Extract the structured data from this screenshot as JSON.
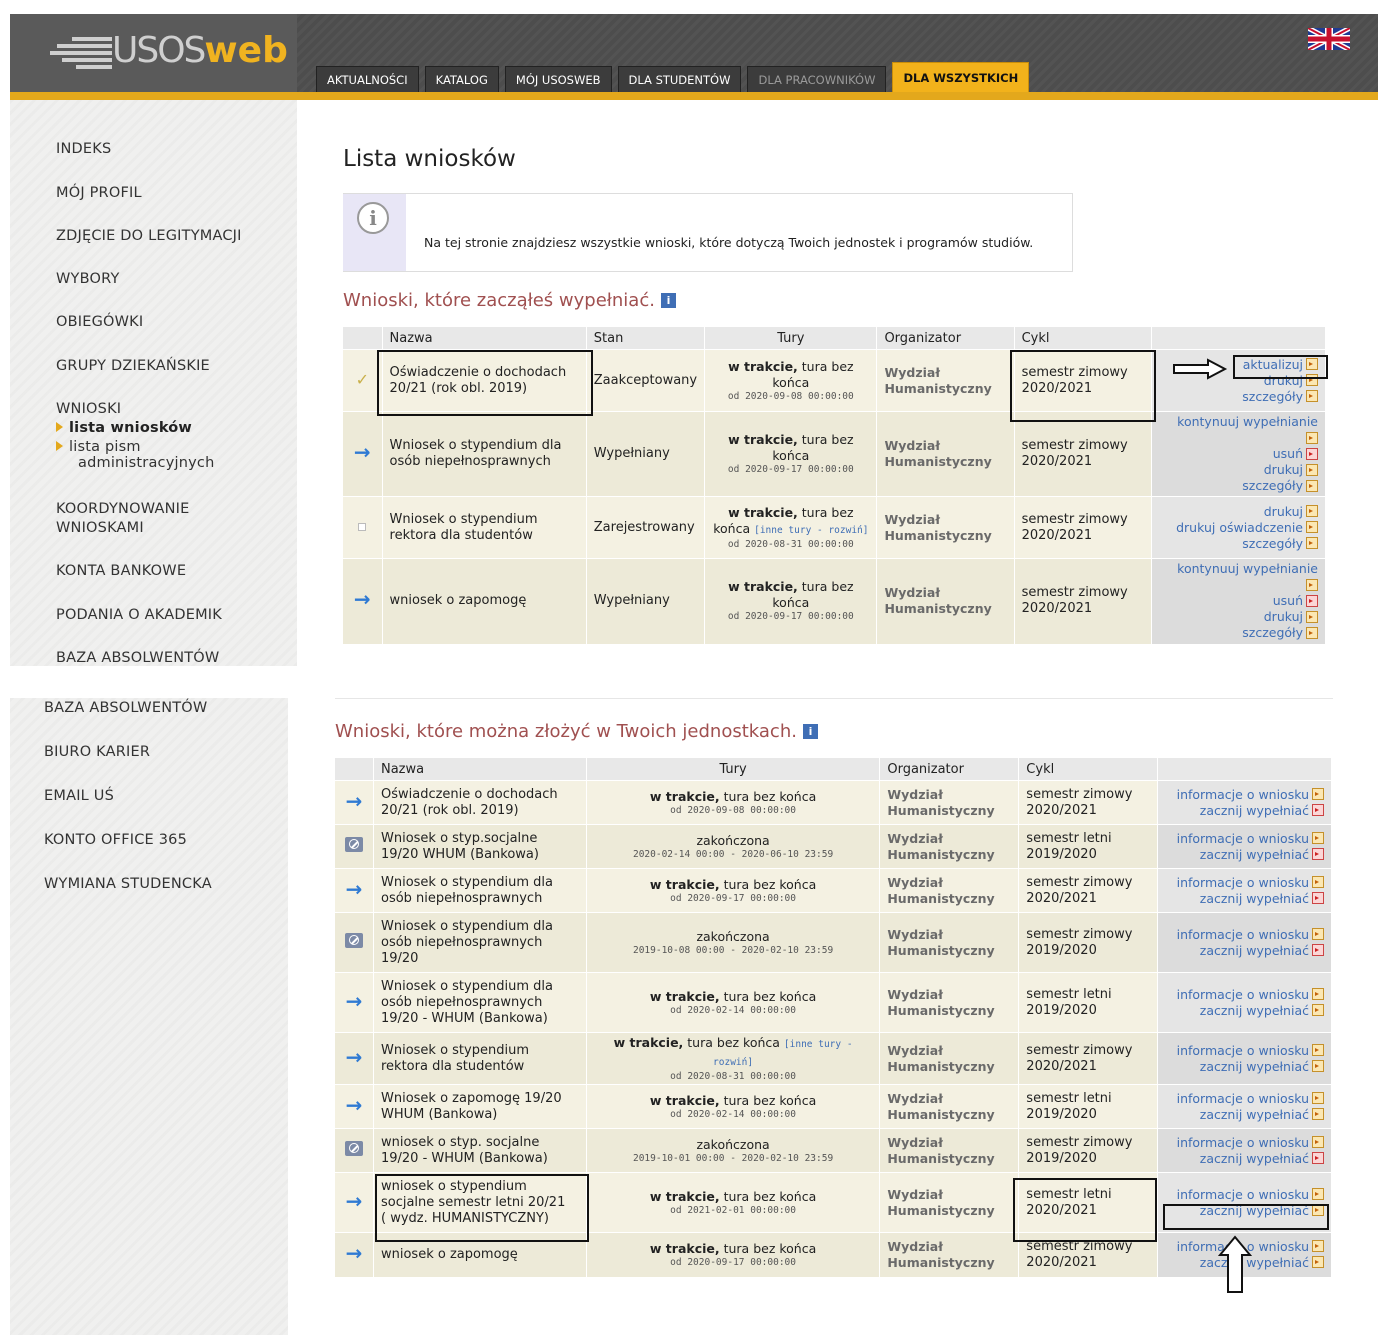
{
  "header": {
    "logo_text_a": "USOS",
    "logo_text_b": "web",
    "tabs": [
      {
        "label": "AKTUALNOŚCI",
        "state": "normal"
      },
      {
        "label": "KATALOG",
        "state": "normal"
      },
      {
        "label": "MÓJ USOSWEB",
        "state": "normal"
      },
      {
        "label": "DLA STUDENTÓW",
        "state": "normal"
      },
      {
        "label": "DLA PRACOWNIKÓW",
        "state": "dim"
      },
      {
        "label": "DLA WSZYSTKICH",
        "state": "active"
      }
    ],
    "flag_icon": "uk-flag-icon",
    "accent": "#e3a81c"
  },
  "sidebar": {
    "items_top": [
      "INDEKS",
      "MÓJ PROFIL",
      "ZDJĘCIE DO LEGITYMACJI",
      "WYBORY",
      "OBIEGÓWKI",
      "GRUPY DZIEKAŃSKIE",
      "WNIOSKI"
    ],
    "sub_items": [
      {
        "label": "lista wniosków",
        "active": true
      },
      {
        "label": "lista pism administracyjnych",
        "label_line1": "lista pism",
        "label_line2": "administracyjnych",
        "active": false
      }
    ],
    "items_mid": [
      {
        "line1": "KOORDYNOWANIE",
        "line2": "WNIOSKAMI"
      }
    ],
    "items_bottom1": [
      "KONTA BANKOWE",
      "PODANIA O AKADEMIK",
      "BAZA ABSOLWENTÓW"
    ],
    "items_bottom2": [
      "BAZA ABSOLWENTÓW",
      "BIURO KARIER",
      "EMAIL UŚ",
      "KONTO OFFICE 365",
      "WYMIANA STUDENCKA"
    ]
  },
  "main": {
    "title": "Lista wniosków",
    "info_text": "Na tej stronie znajdziesz wszystkie wnioski, które dotyczą Twoich jednostek i programów studiów.",
    "section1_title": "Wnioski, które zacząłeś wypełniać.",
    "section2_title": "Wnioski, które można złożyć w Twoich jednostkach.",
    "table1": {
      "headers": [
        "",
        "Nazwa",
        "Stan",
        "Tury",
        "Organizator",
        "Cykl",
        ""
      ],
      "rows": [
        {
          "icon": "check-icon",
          "name": "Oświadczenie o dochodach 20/21 (rok obl. 2019)",
          "name1": "Oświadczenie o dochodach",
          "name2": "20/21 (rok obl. 2019)",
          "state": "Zaakceptowany",
          "tury_bold": "w trakcie,",
          "tury_rest": " tura bez",
          "tury_line2": "końca",
          "tury_more": "",
          "tury_date": "od 2020-09-08 00:00:00",
          "org1": "Wydział",
          "org2": "Humanistyczny",
          "cycle1": "semestr zimowy",
          "cycle2": "2020/2021",
          "actions": [
            {
              "label": "aktualizuj",
              "icon": "arrow-right-icon"
            },
            {
              "label": "drukuj",
              "icon": "arrow-right-icon"
            },
            {
              "label": "szczegóły",
              "icon": "arrow-right-icon"
            }
          ]
        },
        {
          "icon": "arrow-right-icon",
          "name1": "Wniosek o stypendium dla",
          "name2": "osób niepełnosprawnych",
          "state": "Wypełniany",
          "tury_bold": "w trakcie,",
          "tury_rest": " tura bez",
          "tury_line2": "końca",
          "tury_more": "",
          "tury_date": "od 2020-09-17 00:00:00",
          "org1": "Wydział",
          "org2": "Humanistyczny",
          "cycle1": "semestr zimowy",
          "cycle2": "2020/2021",
          "actions": [
            {
              "label": "kontynuuj wypełnianie",
              "icon": "arrow-right-icon"
            },
            {
              "label": "usuń",
              "icon": "delete-icon"
            },
            {
              "label": "drukuj",
              "icon": "arrow-right-icon"
            },
            {
              "label": "szczegóły",
              "icon": "arrow-right-icon"
            }
          ]
        },
        {
          "icon": "square-icon",
          "name1": "Wniosek o stypendium",
          "name2": "rektora dla studentów",
          "state": "Zarejestrowany",
          "tury_bold": "w trakcie,",
          "tury_rest": " tura bez",
          "tury_line2": "końca",
          "tury_more": "[inne tury - rozwiń]",
          "tury_date": "od 2020-08-31 00:00:00",
          "org1": "Wydział",
          "org2": "Humanistyczny",
          "cycle1": "semestr zimowy",
          "cycle2": "2020/2021",
          "actions": [
            {
              "label": "drukuj",
              "icon": "arrow-right-icon"
            },
            {
              "label": "drukuj oświadczenie",
              "icon": "arrow-right-icon"
            },
            {
              "label": "szczegóły",
              "icon": "arrow-right-icon"
            }
          ]
        },
        {
          "icon": "arrow-right-icon",
          "name1": "wniosek o zapomogę",
          "name2": "",
          "state": "Wypełniany",
          "tury_bold": "w trakcie,",
          "tury_rest": " tura bez",
          "tury_line2": "końca",
          "tury_more": "",
          "tury_date": "od 2020-09-17 00:00:00",
          "org1": "Wydział",
          "org2": "Humanistyczny",
          "cycle1": "semestr zimowy",
          "cycle2": "2020/2021",
          "actions": [
            {
              "label": "kontynuuj wypełnianie",
              "icon": "arrow-right-icon"
            },
            {
              "label": "usuń",
              "icon": "delete-icon"
            },
            {
              "label": "drukuj",
              "icon": "arrow-right-icon"
            },
            {
              "label": "szczegóły",
              "icon": "arrow-right-icon"
            }
          ]
        }
      ]
    },
    "table2": {
      "headers": [
        "",
        "Nazwa",
        "Tury",
        "Organizator",
        "Cykl",
        ""
      ],
      "action1": "informacje o wniosku",
      "action2": "zacznij wypełniać",
      "rows": [
        {
          "icon": "arrow-right-icon",
          "name": [
            "Oświadczenie o dochodach",
            "20/21 (rok obl. 2019)"
          ],
          "bold": "w trakcie,",
          "rest": " tura bez końca",
          "more": "",
          "date": "od 2020-09-08 00:00:00",
          "org1": "Wydział",
          "org2": "Humanistyczny",
          "cycle1": "semestr zimowy",
          "cycle2": "2020/2021",
          "start_icon": "delete-icon"
        },
        {
          "icon": "no-entry-icon",
          "name": [
            "Wniosek o styp.socjalne",
            "19/20 WHUM (Bankowa)"
          ],
          "bold": "",
          "rest": "zakończona",
          "more": "",
          "date": "2020-02-14 00:00 - 2020-06-10 23:59",
          "org1": "Wydział",
          "org2": "Humanistyczny",
          "cycle1": "semestr letni",
          "cycle2": "2019/2020",
          "start_icon": "delete-icon"
        },
        {
          "icon": "arrow-right-icon",
          "name": [
            "Wniosek o stypendium dla",
            "osób niepełnosprawnych"
          ],
          "bold": "w trakcie,",
          "rest": " tura bez końca",
          "more": "",
          "date": "od 2020-09-17 00:00:00",
          "org1": "Wydział",
          "org2": "Humanistyczny",
          "cycle1": "semestr zimowy",
          "cycle2": "2020/2021",
          "start_icon": "delete-icon"
        },
        {
          "icon": "no-entry-icon",
          "name": [
            "Wniosek o stypendium dla",
            "osób niepełnosprawnych",
            "19/20"
          ],
          "bold": "",
          "rest": "zakończona",
          "more": "",
          "date": "2019-10-08 00:00 - 2020-02-10 23:59",
          "org1": "Wydział",
          "org2": "Humanistyczny",
          "cycle1": "semestr zimowy",
          "cycle2": "2019/2020",
          "start_icon": "delete-icon"
        },
        {
          "icon": "arrow-right-icon",
          "name": [
            "Wniosek o stypendium dla",
            "osób niepełnosprawnych",
            "19/20 - WHUM (Bankowa)"
          ],
          "bold": "w trakcie,",
          "rest": " tura bez końca",
          "more": "",
          "date": "od 2020-02-14 00:00:00",
          "org1": "Wydział",
          "org2": "Humanistyczny",
          "cycle1": "semestr letni",
          "cycle2": "2019/2020",
          "start_icon": "arrow-right-icon"
        },
        {
          "icon": "arrow-right-icon",
          "name": [
            "Wniosek o stypendium",
            "rektora dla studentów"
          ],
          "bold": "w trakcie,",
          "rest": " tura bez końca",
          "more": "[inne tury - rozwiń]",
          "date": "od 2020-08-31 00:00:00",
          "org1": "Wydział",
          "org2": "Humanistyczny",
          "cycle1": "semestr zimowy",
          "cycle2": "2020/2021",
          "start_icon": "arrow-right-icon"
        },
        {
          "icon": "arrow-right-icon",
          "name": [
            "Wniosek o zapomogę 19/20",
            "WHUM (Bankowa)"
          ],
          "bold": "w trakcie,",
          "rest": " tura bez końca",
          "more": "",
          "date": "od 2020-02-14 00:00:00",
          "org1": "Wydział",
          "org2": "Humanistyczny",
          "cycle1": "semestr letni",
          "cycle2": "2019/2020",
          "start_icon": "arrow-right-icon"
        },
        {
          "icon": "no-entry-icon",
          "name": [
            "wniosek o styp. socjalne",
            "19/20 - WHUM (Bankowa)"
          ],
          "bold": "",
          "rest": "zakończona",
          "more": "",
          "date": "2019-10-01 00:00 - 2020-02-10 23:59",
          "org1": "Wydział",
          "org2": "Humanistyczny",
          "cycle1": "semestr zimowy",
          "cycle2": "2019/2020",
          "start_icon": "delete-icon"
        },
        {
          "icon": "arrow-right-icon",
          "name": [
            "wniosek o stypendium",
            "socjalne semestr letni 20/21",
            "( wydz. HUMANISTYCZNY)"
          ],
          "bold": "w trakcie,",
          "rest": " tura bez końca",
          "more": "",
          "date": "od 2021-02-01 00:00:00",
          "org1": "Wydział",
          "org2": "Humanistyczny",
          "cycle1": "semestr letni",
          "cycle2": "2020/2021",
          "start_icon": "arrow-right-icon"
        },
        {
          "icon": "arrow-right-icon",
          "name": [
            "wniosek o zapomogę"
          ],
          "bold": "w trakcie,",
          "rest": " tura bez końca",
          "more": "",
          "date": "od 2020-09-17 00:00:00",
          "org1": "Wydział",
          "org2": "Humanistyczny",
          "cycle1": "semestr zimowy",
          "cycle2": "2020/2021",
          "start_icon": "arrow-right-icon"
        }
      ]
    }
  }
}
